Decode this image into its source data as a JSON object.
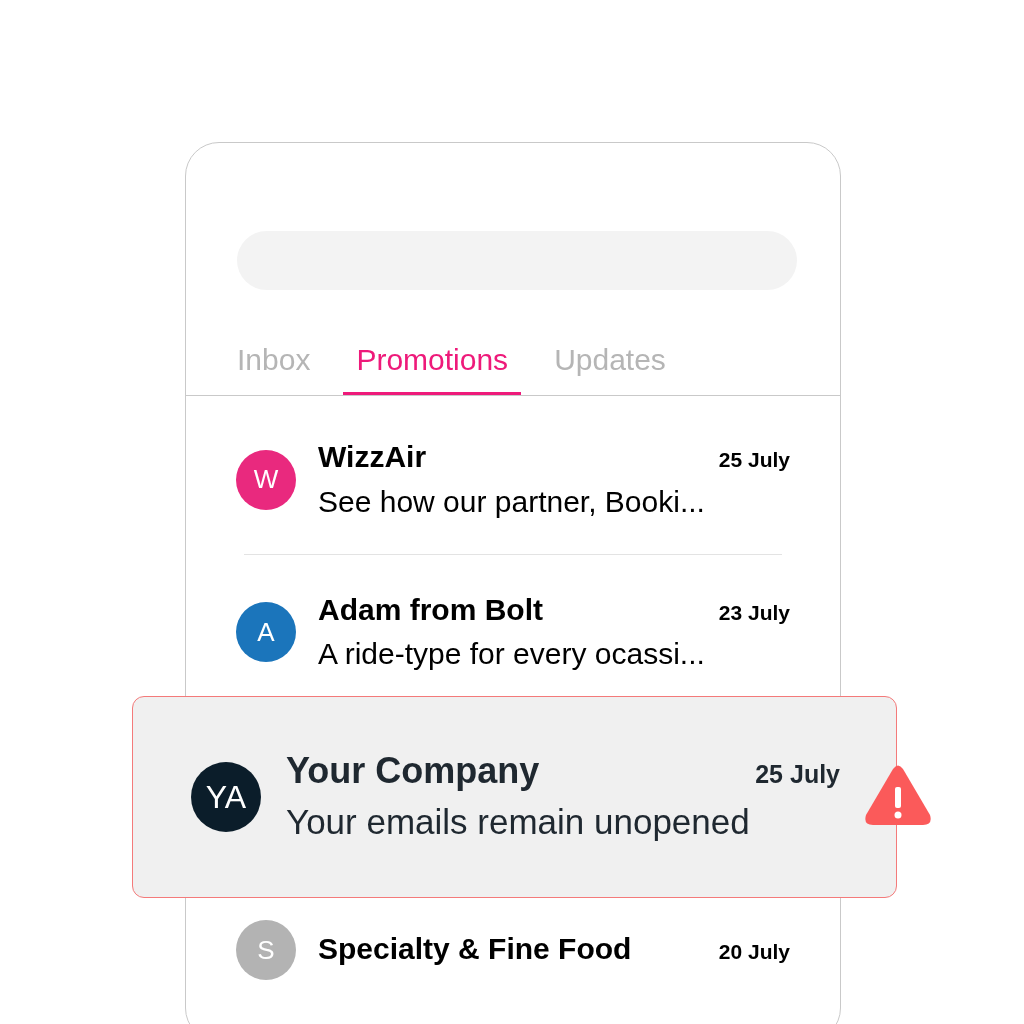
{
  "tabs": [
    {
      "label": "Inbox",
      "selected": false
    },
    {
      "label": "Promotions",
      "selected": true
    },
    {
      "label": "Updates",
      "selected": false
    }
  ],
  "emails": [
    {
      "kind": "normal",
      "initials": "W",
      "color": "#e9297e",
      "sender": "WizzAir",
      "date": "25 July",
      "preview": "See how our partner, Booki..."
    },
    {
      "kind": "normal",
      "initials": "A",
      "color": "#1b75bb",
      "sender": "Adam from Bolt",
      "date": "23 July",
      "preview": "A ride-type for every ocassi..."
    },
    {
      "kind": "alert",
      "initials": "YA",
      "color": "#0b1d2a",
      "sender": "Your Company",
      "date": "25 July",
      "preview": "Your emails remain unopened"
    },
    {
      "kind": "normal",
      "initials": "S",
      "color": "#b3b3b3",
      "sender": "Specialty & Fine Food",
      "date": "20 July"
    }
  ]
}
